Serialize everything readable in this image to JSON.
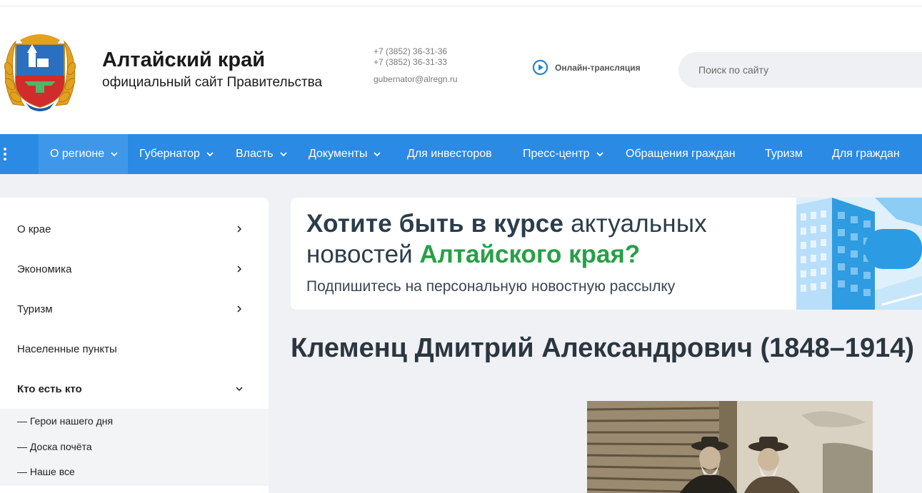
{
  "header": {
    "title": "Алтайский край",
    "subtitle": "официальный сайт Правительства",
    "phone_1": "+7 (3852) 36-31-36",
    "phone_2": "+7 (3852) 36-31-33",
    "email": "gubernator@alregn.ru",
    "live_label": "Онлайн-трансляция",
    "search_placeholder": "Поиск по сайту"
  },
  "nav": {
    "items": [
      {
        "label": "О регионе",
        "has_dropdown": true,
        "active": true
      },
      {
        "label": "Губернатор",
        "has_dropdown": true
      },
      {
        "label": "Власть",
        "has_dropdown": true
      },
      {
        "label": "Документы",
        "has_dropdown": true
      },
      {
        "label": "Для инвесторов",
        "has_dropdown": false
      },
      {
        "label": "Пресс-центр",
        "has_dropdown": true
      },
      {
        "label": "Обращения граждан",
        "has_dropdown": false
      },
      {
        "label": "Туризм",
        "has_dropdown": false
      },
      {
        "label": "Для граждан",
        "has_dropdown": false
      }
    ]
  },
  "sidebar": {
    "items": [
      {
        "label": "О крае",
        "icon": "chevron-right-icon"
      },
      {
        "label": "Экономика",
        "icon": "chevron-right-icon"
      },
      {
        "label": "Туризм",
        "icon": "chevron-right-icon"
      },
      {
        "label": "Населенные пункты"
      },
      {
        "label": "Кто есть кто",
        "icon": "chevron-down-icon",
        "expanded": true
      }
    ],
    "subitems": [
      {
        "label": "— Герои нашего дня"
      },
      {
        "label": "— Доска почёта"
      },
      {
        "label": "— Наше все"
      }
    ]
  },
  "banner": {
    "line1_bold": "Хотите быть в курсе",
    "line1_light": " актуальных",
    "line2_start": "новостей ",
    "line2_green": "Алтайского края?",
    "line3": "Подпишитесь на персональную новостную рассылку"
  },
  "main": {
    "page_title": "Клеменц Дмитрий Александрович (1848–1914)"
  },
  "colors": {
    "nav_bg": "#2b8ae3",
    "nav_active": "#3f97ea",
    "content_bg": "#eff1f4",
    "banner_green": "#27a046",
    "title_dark": "#2b3640"
  }
}
